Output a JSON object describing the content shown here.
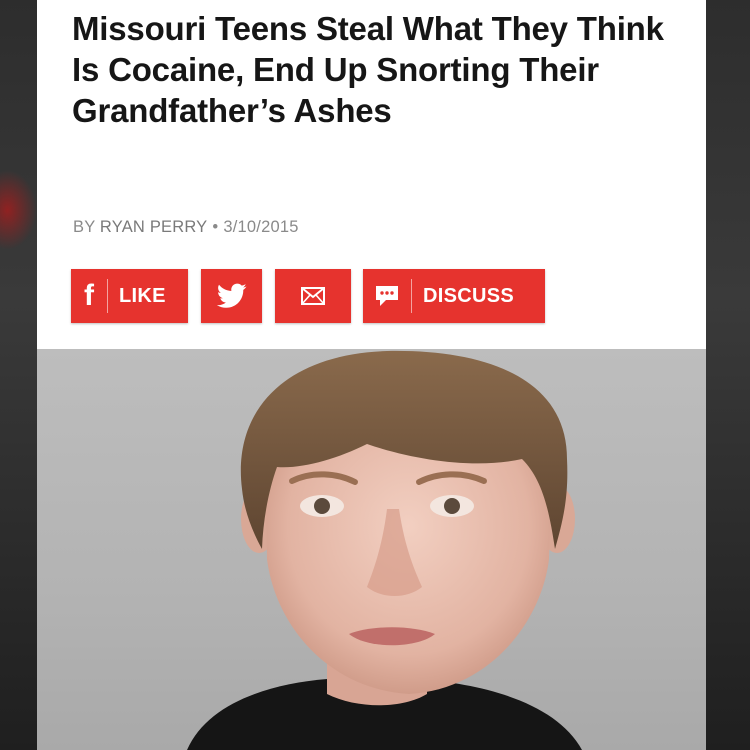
{
  "article": {
    "headline": "Missouri Teens Steal What They Think Is Cocaine, End Up Snorting Their Grandfather’s Ashes",
    "byline_prefix": "BY",
    "author": "RYAN PERRY",
    "separator": "•",
    "date": "3/10/2015"
  },
  "share": {
    "like_label": "LIKE",
    "discuss_label": "DISCUSS",
    "facebook_glyph": "f",
    "icons": [
      "facebook-icon",
      "twitter-icon",
      "email-icon",
      "comment-icon"
    ]
  },
  "photo": {
    "subject": "mugshot-photo"
  },
  "colors": {
    "accent": "#e6332e",
    "headline": "#161616",
    "byline": "#8a8a8a",
    "background": "#ffffff"
  }
}
